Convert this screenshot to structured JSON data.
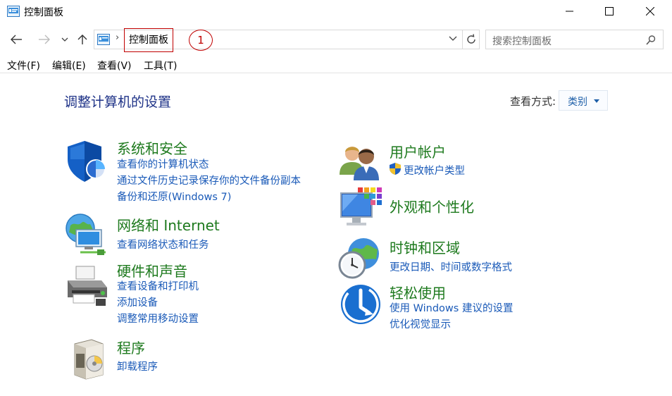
{
  "window": {
    "title": "控制面板"
  },
  "address": {
    "crumb": "控制面板",
    "annotation": "1"
  },
  "search": {
    "placeholder": "搜索控制面板"
  },
  "menu": {
    "file": "文件(F)",
    "edit": "编辑(E)",
    "view": "查看(V)",
    "tools": "工具(T)"
  },
  "main": {
    "title": "调整计算机的设置",
    "view_by_label": "查看方式:",
    "view_by_value": "类别"
  },
  "categories": {
    "system": {
      "title": "系统和安全",
      "links": [
        "查看你的计算机状态",
        "通过文件历史记录保存你的文件备份副本",
        "备份和还原(Windows 7)"
      ]
    },
    "network": {
      "title": "网络和 Internet",
      "links": [
        "查看网络状态和任务"
      ]
    },
    "hardware": {
      "title": "硬件和声音",
      "links": [
        "查看设备和打印机",
        "添加设备",
        "调整常用移动设置"
      ]
    },
    "programs": {
      "title": "程序",
      "links": [
        "卸载程序"
      ]
    },
    "accounts": {
      "title": "用户帐户",
      "links": [
        "更改帐户类型"
      ]
    },
    "appearance": {
      "title": "外观和个性化",
      "links": []
    },
    "clock": {
      "title": "时钟和区域",
      "links": [
        "更改日期、时间或数字格式"
      ]
    },
    "ease": {
      "title": "轻松使用",
      "links": [
        "使用 Windows 建议的设置",
        "优化视觉显示"
      ]
    }
  },
  "colors": {
    "category_title": "#1e7a1e",
    "link": "#1a5ab8",
    "page_title": "#1e3287",
    "annotation": "#c00000"
  }
}
